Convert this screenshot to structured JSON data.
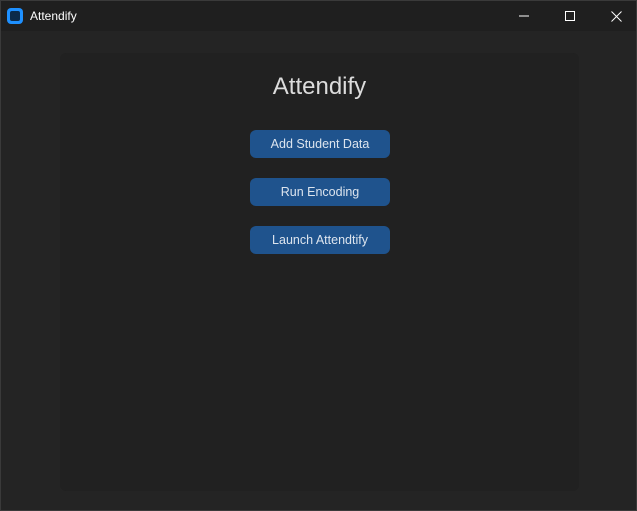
{
  "window": {
    "title": "Attendify",
    "controls": {
      "minimize_icon": "minimize-icon",
      "maximize_icon": "maximize-icon",
      "close_icon": "close-icon"
    }
  },
  "main": {
    "heading": "Attendify",
    "buttons": [
      {
        "label": "Add Student Data"
      },
      {
        "label": "Run Encoding"
      },
      {
        "label": "Launch Attendtify"
      }
    ]
  },
  "colors": {
    "background": "#242424",
    "frame": "#212121",
    "button": "#1f538d",
    "button_text": "#dce4ee",
    "heading_text": "#dcdcdc",
    "app_icon": "#1e90ff"
  }
}
